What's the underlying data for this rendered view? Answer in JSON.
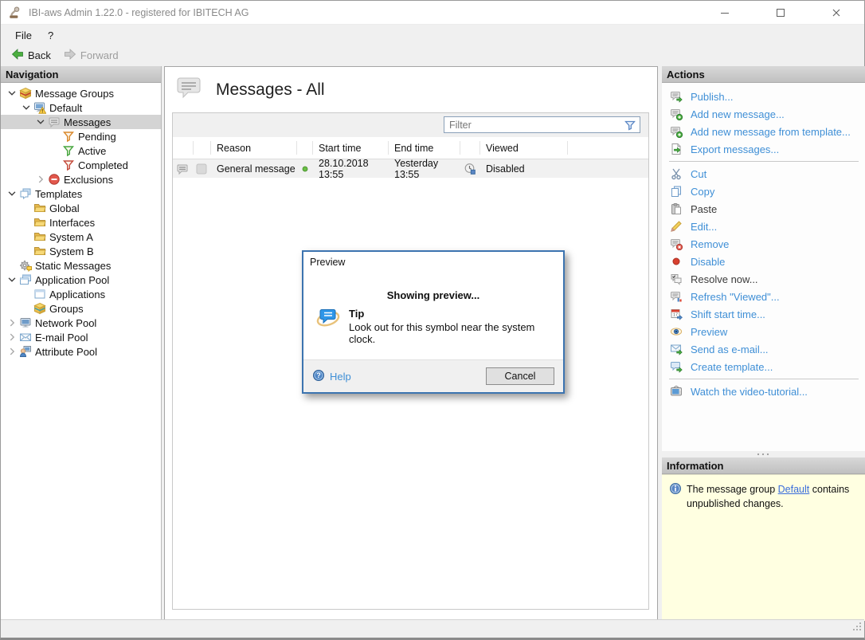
{
  "window": {
    "title": "IBI-aws Admin 1.22.0 - registered for IBITECH AG"
  },
  "menu": {
    "items": [
      "File",
      "?"
    ]
  },
  "toolbar": {
    "back_label": "Back",
    "forward_label": "Forward"
  },
  "navigation": {
    "header": "Navigation",
    "tree": [
      {
        "label": "Message Groups",
        "level": 0,
        "chevron": "expanded",
        "icon": "message-groups",
        "selected": false
      },
      {
        "label": "Default",
        "level": 1,
        "chevron": "expanded",
        "icon": "group-default",
        "selected": false
      },
      {
        "label": "Messages",
        "level": 2,
        "chevron": "expanded",
        "icon": "messages",
        "selected": true
      },
      {
        "label": "Pending",
        "level": 3,
        "chevron": "none",
        "icon": "funnel-pending",
        "selected": false
      },
      {
        "label": "Active",
        "level": 3,
        "chevron": "none",
        "icon": "funnel-active",
        "selected": false
      },
      {
        "label": "Completed",
        "level": 3,
        "chevron": "none",
        "icon": "funnel-completed",
        "selected": false
      },
      {
        "label": "Exclusions",
        "level": 2,
        "chevron": "collapsed",
        "icon": "exclusions",
        "selected": false
      },
      {
        "label": "Templates",
        "level": 0,
        "chevron": "expanded",
        "icon": "templates",
        "selected": false
      },
      {
        "label": "Global",
        "level": 1,
        "chevron": "none",
        "icon": "folder",
        "selected": false
      },
      {
        "label": "Interfaces",
        "level": 1,
        "chevron": "none",
        "icon": "folder",
        "selected": false
      },
      {
        "label": "System A",
        "level": 1,
        "chevron": "none",
        "icon": "folder",
        "selected": false
      },
      {
        "label": "System B",
        "level": 1,
        "chevron": "none",
        "icon": "folder",
        "selected": false
      },
      {
        "label": "Static Messages",
        "level": 0,
        "chevron": "none",
        "icon": "static-messages",
        "selected": false
      },
      {
        "label": "Application Pool",
        "level": 0,
        "chevron": "expanded",
        "icon": "application-pool",
        "selected": false
      },
      {
        "label": "Applications",
        "level": 1,
        "chevron": "none",
        "icon": "applications",
        "selected": false
      },
      {
        "label": "Groups",
        "level": 1,
        "chevron": "none",
        "icon": "groups",
        "selected": false
      },
      {
        "label": "Network Pool",
        "level": 0,
        "chevron": "collapsed",
        "icon": "network-pool",
        "selected": false
      },
      {
        "label": "E-mail Pool",
        "level": 0,
        "chevron": "collapsed",
        "icon": "email-pool",
        "selected": false
      },
      {
        "label": "Attribute Pool",
        "level": 0,
        "chevron": "collapsed",
        "icon": "attribute-pool",
        "selected": false
      }
    ]
  },
  "content": {
    "title": "Messages - All",
    "filter_placeholder": "Filter",
    "table": {
      "columns": [
        "Reason",
        "Start time",
        "End time",
        "Viewed"
      ],
      "rows": [
        {
          "reason": "General message",
          "status": "active",
          "start_time": "28.10.2018 13:55",
          "end_time": "Yesterday 13:55",
          "viewed": "Disabled"
        }
      ]
    }
  },
  "actions": {
    "header": "Actions",
    "items": [
      {
        "label": "Publish...",
        "icon": "publish",
        "enabled": true
      },
      {
        "label": "Add new message...",
        "icon": "add-new-message",
        "enabled": true
      },
      {
        "label": "Add new message from template...",
        "icon": "add-from-template",
        "enabled": true
      },
      {
        "label": "Export messages...",
        "icon": "export-messages",
        "enabled": true
      },
      {
        "separator": true
      },
      {
        "label": "Cut",
        "icon": "cut",
        "enabled": true
      },
      {
        "label": "Copy",
        "icon": "copy",
        "enabled": true
      },
      {
        "label": "Paste",
        "icon": "paste",
        "enabled": false
      },
      {
        "label": "Edit...",
        "icon": "edit",
        "enabled": true
      },
      {
        "label": "Remove",
        "icon": "remove",
        "enabled": true
      },
      {
        "label": "Disable",
        "icon": "disable",
        "enabled": true
      },
      {
        "label": "Resolve now...",
        "icon": "resolve-now",
        "enabled": false
      },
      {
        "label": "Refresh \"Viewed\"...",
        "icon": "refresh-viewed",
        "enabled": true
      },
      {
        "label": "Shift start time...",
        "icon": "shift-start-time",
        "enabled": true
      },
      {
        "label": "Preview",
        "icon": "preview",
        "enabled": true
      },
      {
        "label": "Send as e-mail...",
        "icon": "send-email",
        "enabled": true
      },
      {
        "label": "Create template...",
        "icon": "create-template",
        "enabled": true
      },
      {
        "separator": true
      },
      {
        "label": "Watch the video-tutorial...",
        "icon": "video-tutorial",
        "enabled": true
      }
    ]
  },
  "information": {
    "header": "Information",
    "text_before": "The message group ",
    "link_text": "Default",
    "text_after": " contains unpublished changes."
  },
  "dialog": {
    "title": "Preview",
    "message": "Showing preview...",
    "tip_title": "Tip",
    "tip_text": "Look out for this symbol near the system clock.",
    "help_label": "Help",
    "cancel_label": "Cancel"
  },
  "colors": {
    "action_link": "#3f8fd6",
    "info_panel_bg": "#ffffe1",
    "dialog_border": "#3c74b0",
    "selected_row": "#d4d4d4",
    "back_arrow": "#4caf3f"
  }
}
